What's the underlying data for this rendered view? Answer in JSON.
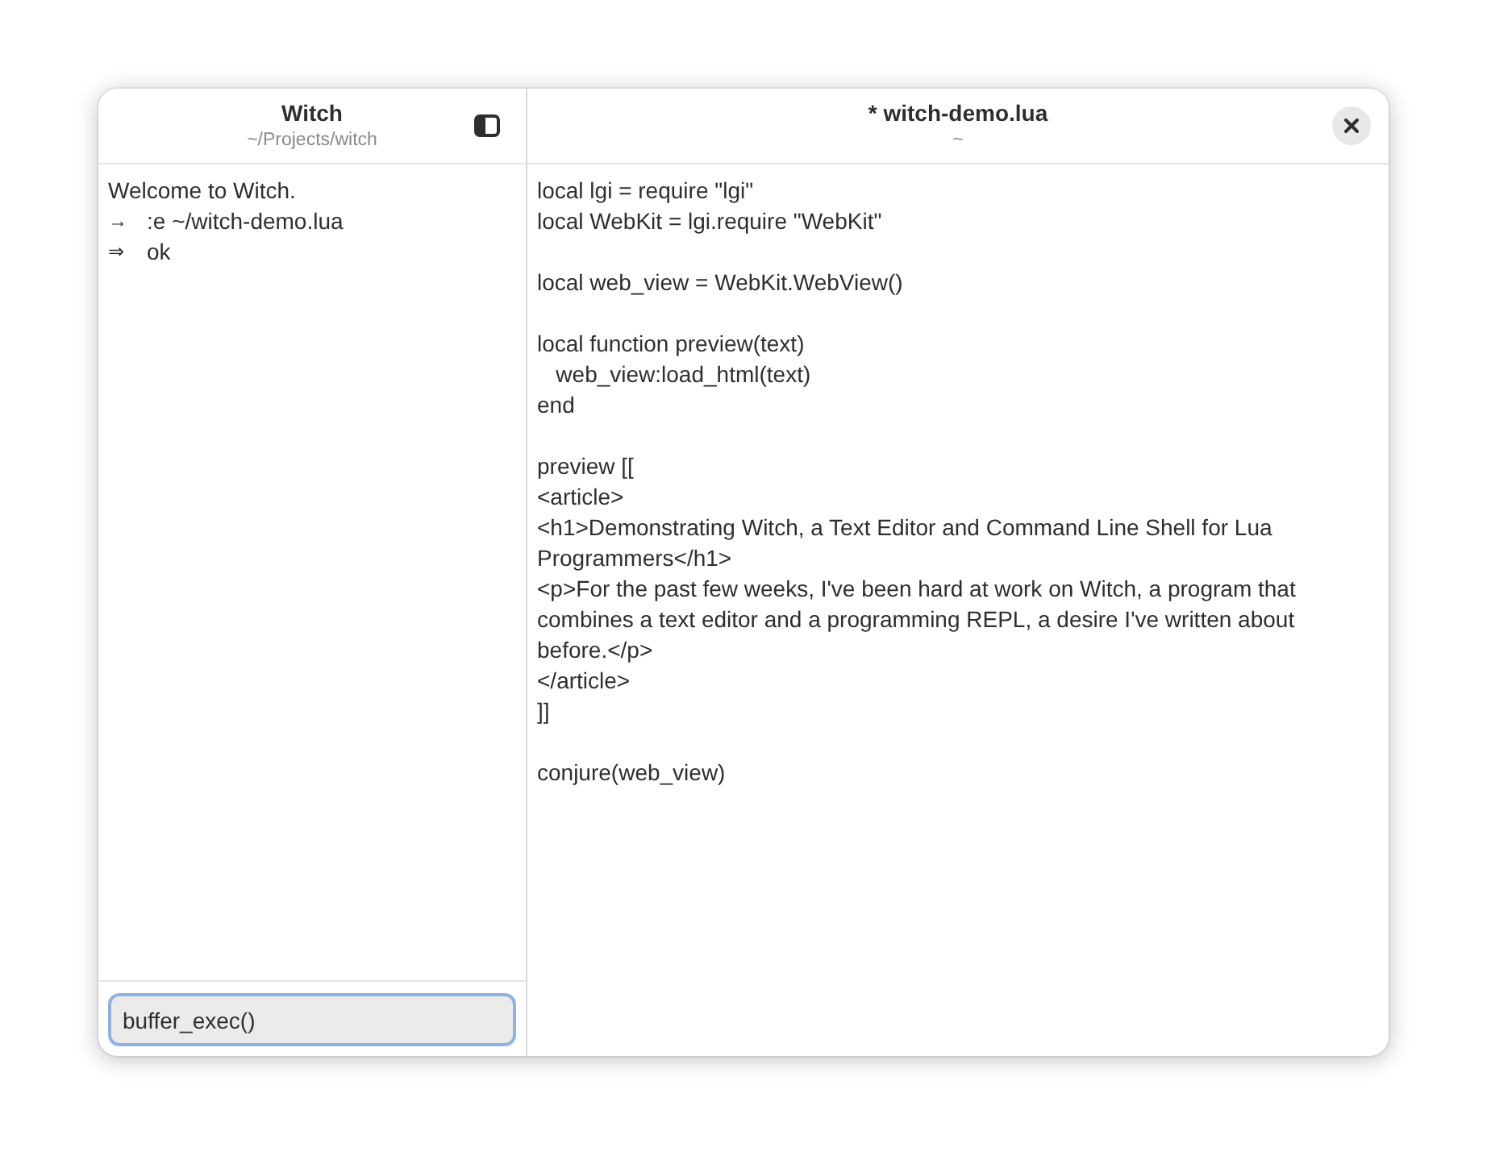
{
  "sidebar": {
    "title": "Witch",
    "subtitle": "~/Projects/witch",
    "log": [
      {
        "text": "Welcome to Witch."
      },
      {
        "marker": "→",
        "text": ":e ~/witch-demo.lua"
      },
      {
        "marker": "⇒",
        "text": "ok"
      }
    ],
    "command": {
      "value": "buffer_exec()",
      "focused": true
    }
  },
  "editor": {
    "title": "* witch-demo.lua",
    "subtitle": "~",
    "blocks": [
      [
        "local lgi = require \"lgi\"",
        "local WebKit = lgi.require \"WebKit\""
      ],
      [
        "local web_view = WebKit.WebView()"
      ],
      [
        "local function preview(text)",
        "\tweb_view:load_html(text)",
        "end"
      ],
      [
        "preview [[",
        "<article>",
        "<h1>Demonstrating Witch, a Text Editor and Command Line Shell for Lua",
        "Programmers</h1>",
        "<p>For the past few weeks, I've been hard at work on Witch, a program that",
        "combines a text editor and a programming REPL, a desire I've written about",
        "before.</p>",
        "</article>",
        "]]"
      ],
      [
        "conjure(web_view)"
      ]
    ]
  }
}
